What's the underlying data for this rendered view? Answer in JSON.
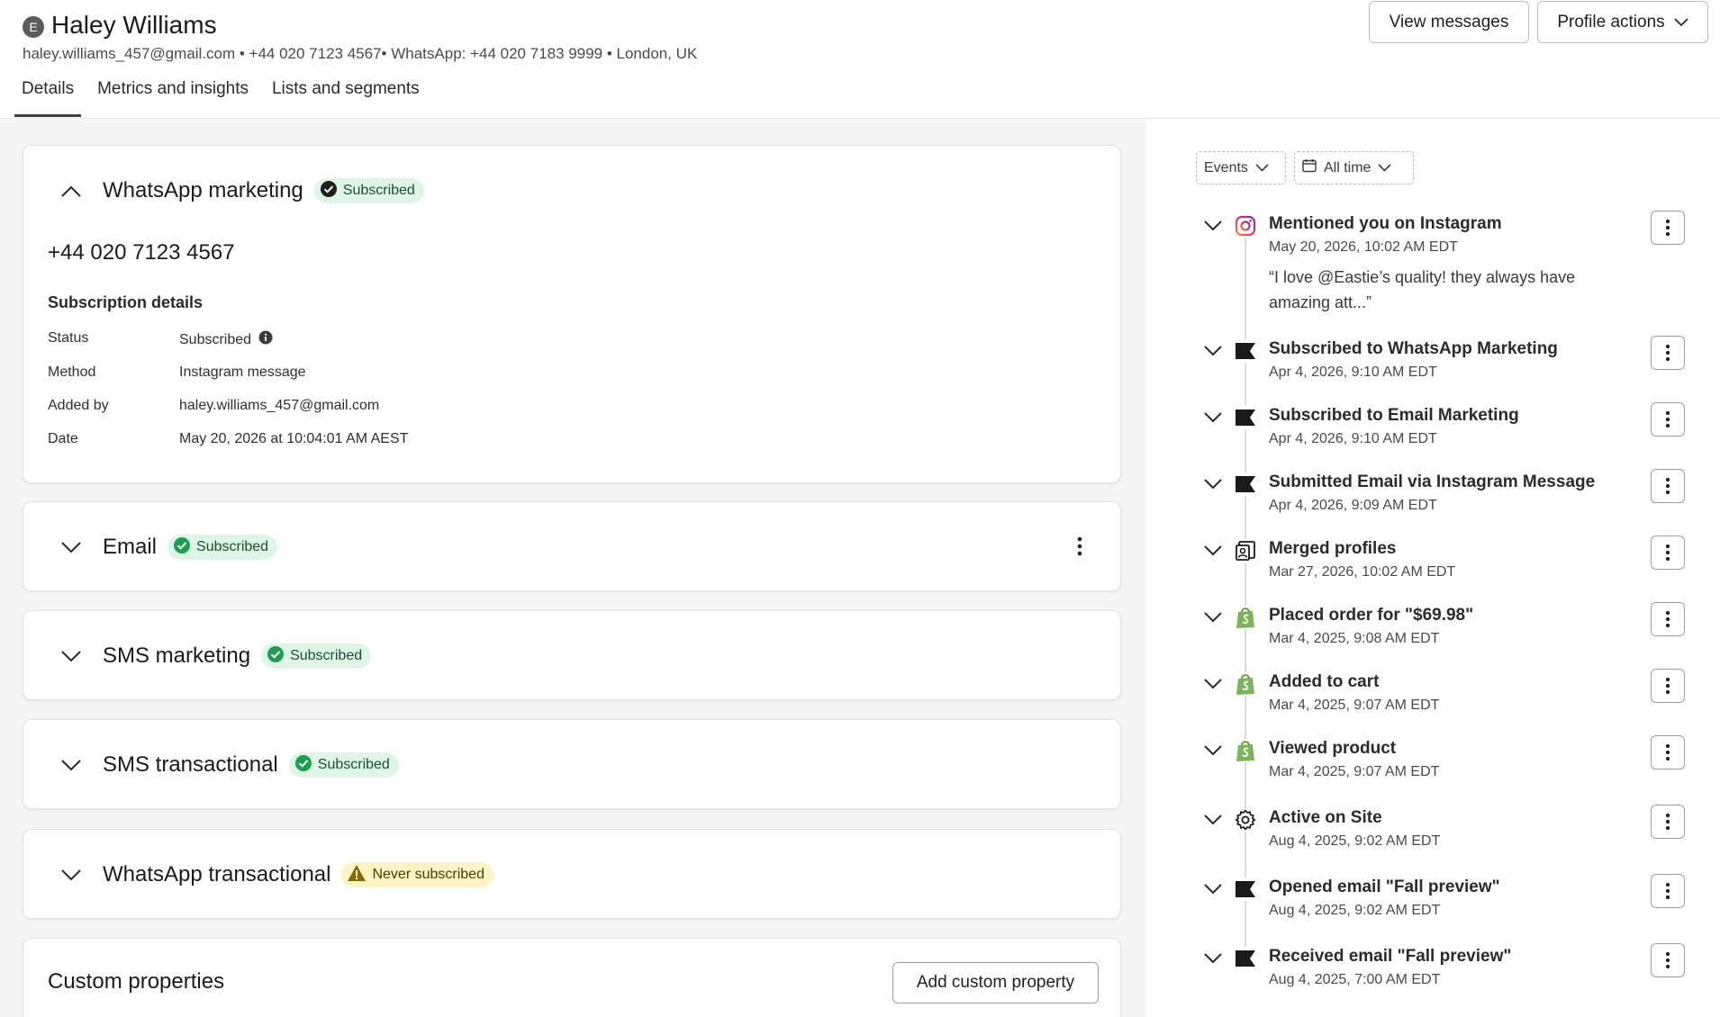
{
  "profile": {
    "avatar_letter": "E",
    "name": "Haley Williams",
    "contact_line": "haley.williams_457@gmail.com • +44 020 7123 4567• WhatsApp: +44 020 7183 9999 • London, UK"
  },
  "header_buttons": {
    "view_messages": "View messages",
    "profile_actions": "Profile actions"
  },
  "tabs": [
    {
      "label": "Details",
      "active": true
    },
    {
      "label": "Metrics and insights",
      "active": false
    },
    {
      "label": "Lists and segments",
      "active": false
    }
  ],
  "channels": {
    "whatsapp_marketing": {
      "title": "WhatsApp marketing",
      "status": "Subscribed",
      "phone": "+44 020 7123 4567",
      "details_title": "Subscription details",
      "details": [
        {
          "key": "Status",
          "value": "Subscribed"
        },
        {
          "key": "Method",
          "value": "Instagram message"
        },
        {
          "key": "Added by",
          "value": "haley.williams_457@gmail.com"
        },
        {
          "key": "Date",
          "value": "May 20, 2026 at 10:04:01 AM AEST"
        }
      ]
    },
    "email": {
      "title": "Email",
      "status": "Subscribed"
    },
    "sms_marketing": {
      "title": "SMS marketing",
      "status": "Subscribed"
    },
    "sms_transactional": {
      "title": "SMS transactional",
      "status": "Subscribed"
    },
    "whatsapp_transactional": {
      "title": "WhatsApp transactional",
      "status": "Never subscribed"
    }
  },
  "custom_properties": {
    "title": "Custom properties",
    "add_button": "Add custom property"
  },
  "filters": {
    "events": "Events",
    "time": "All time"
  },
  "events": [
    {
      "icon": "instagram-icon",
      "title": "Mentioned you on Instagram",
      "date": "May 20, 2026, 10:02 AM EDT",
      "quote": "“I love @Eastie’s quality! they always have amazing att...”"
    },
    {
      "icon": "flag-icon",
      "title": "Subscribed to WhatsApp Marketing",
      "date": "Apr 4, 2026, 9:10 AM EDT"
    },
    {
      "icon": "flag-icon",
      "title": "Subscribed to Email Marketing",
      "date": "Apr 4, 2026, 9:10 AM EDT"
    },
    {
      "icon": "flag-icon",
      "title": "Submitted Email via Instagram Message",
      "date": "Apr 4, 2026, 9:09 AM EDT"
    },
    {
      "icon": "merge-profile-icon",
      "title": "Merged profiles",
      "date": "Mar 27, 2026, 10:02 AM EDT"
    },
    {
      "icon": "shopify-icon",
      "title": "Placed order for \"$69.98\"",
      "date": "Mar 4, 2025, 9:08 AM EDT"
    },
    {
      "icon": "shopify-icon",
      "title": "Added to cart",
      "date": "Mar 4, 2025, 9:07 AM EDT"
    },
    {
      "icon": "shopify-icon",
      "title": "Viewed product",
      "date": "Mar 4, 2025, 9:07 AM EDT"
    },
    {
      "icon": "gear-icon",
      "title": "Active on Site",
      "date": "Aug 4, 2025, 9:02 AM EDT"
    },
    {
      "icon": "flag-icon",
      "title": "Opened email \"Fall preview\"",
      "date": "Aug 4, 2025, 9:02 AM EDT"
    },
    {
      "icon": "flag-icon",
      "title": "Received email \"Fall preview\"",
      "date": "Aug 4, 2025, 7:00 AM EDT"
    }
  ],
  "colors": {
    "subscribed_badge_bg": "#dff6e6",
    "subscribed_check": "#1e9e4f",
    "never_badge_bg": "#fdf3c4",
    "warning_icon": "#8a6a00",
    "shopify_green": "#7ab55c",
    "instagram_gradient": [
      "#f58529",
      "#dd2a7b",
      "#8134af"
    ]
  }
}
